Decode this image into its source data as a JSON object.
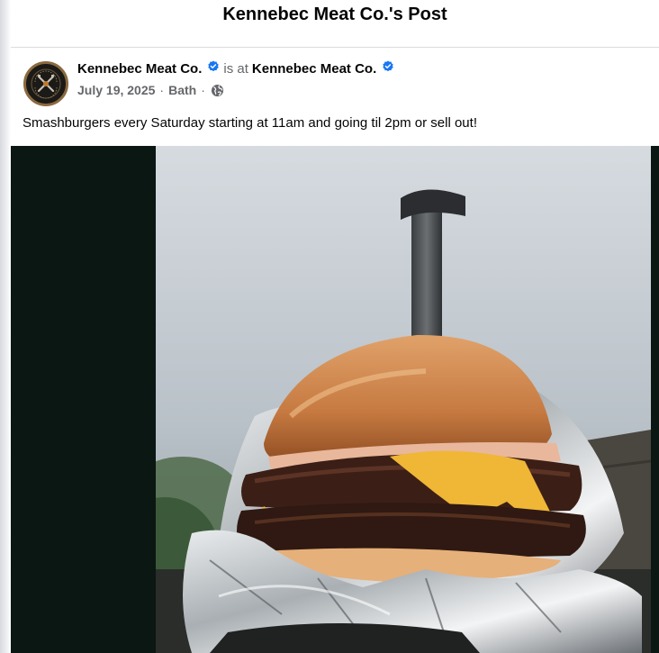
{
  "dialog": {
    "title": "Kennebec Meat Co.'s Post"
  },
  "post": {
    "author": "Kennebec Meat Co.",
    "check_in_prefix": "is at",
    "location_page": "Kennebec Meat Co.",
    "date": "July 19, 2025",
    "separator": "·",
    "place": "Bath",
    "audience_icon": "globe-icon",
    "verified_icon": "verified-badge-icon",
    "text": "Smashburgers every Saturday starting at 11am and going til 2pm or sell out!"
  },
  "colors": {
    "verified": "#1877f2",
    "secondary_text": "#65676b",
    "media_background": "#0b1713"
  }
}
